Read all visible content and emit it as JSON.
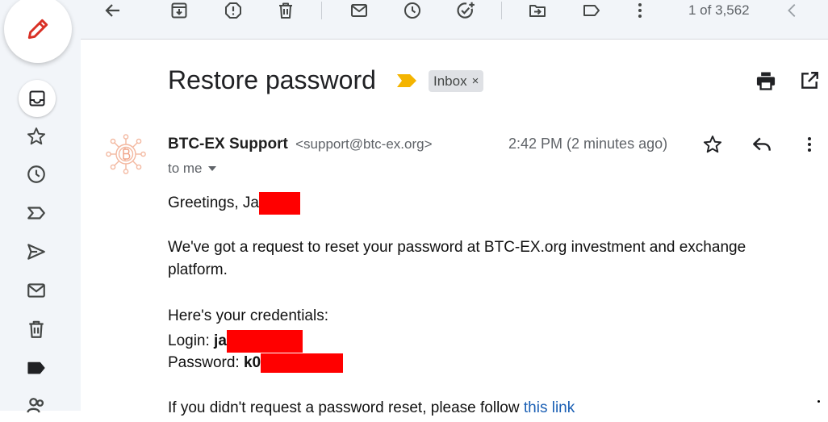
{
  "toolbar": {
    "counter": "1 of 3,562"
  },
  "email": {
    "subject": "Restore password",
    "label": "Inbox",
    "label_remove": "×",
    "sender_name": "BTC-EX Support",
    "sender_email": "<support@btc-ex.org>",
    "time": "2:42 PM (2 minutes ago)",
    "recipient": "to me",
    "body": {
      "greeting": "Greetings, Ja",
      "para1_line1": "We've got a request to reset your password at BTC-EX.org investment and exchange",
      "para1_line2": "platform.",
      "credentials_intro": "Here's your credentials:",
      "login_label": "Login: ",
      "login_value_visible": "ja",
      "password_label": "Password: ",
      "password_value_visible": "k0",
      "footer_text": "If you didn't request a password reset, please follow ",
      "footer_link": "this link"
    }
  },
  "colors": {
    "app_background": "#f2f5f9",
    "redaction": "#ff0000",
    "compose_pencil": "#d93025",
    "importance_marker": "#f4b400",
    "link": "#1a5fb4"
  },
  "icons": {
    "rail": [
      "inbox-icon",
      "star-icon",
      "clock-icon",
      "important-icon",
      "send-icon",
      "mail-icon",
      "trash-icon",
      "label-icon",
      "contacts-icon"
    ],
    "toolbar": [
      "back-arrow-icon",
      "archive-icon",
      "report-spam-icon",
      "delete-icon",
      "mark-unread-icon",
      "snooze-icon",
      "add-to-tasks-icon",
      "move-to-icon",
      "label-icon",
      "more-vert-icon",
      "chevron-left-icon"
    ]
  }
}
